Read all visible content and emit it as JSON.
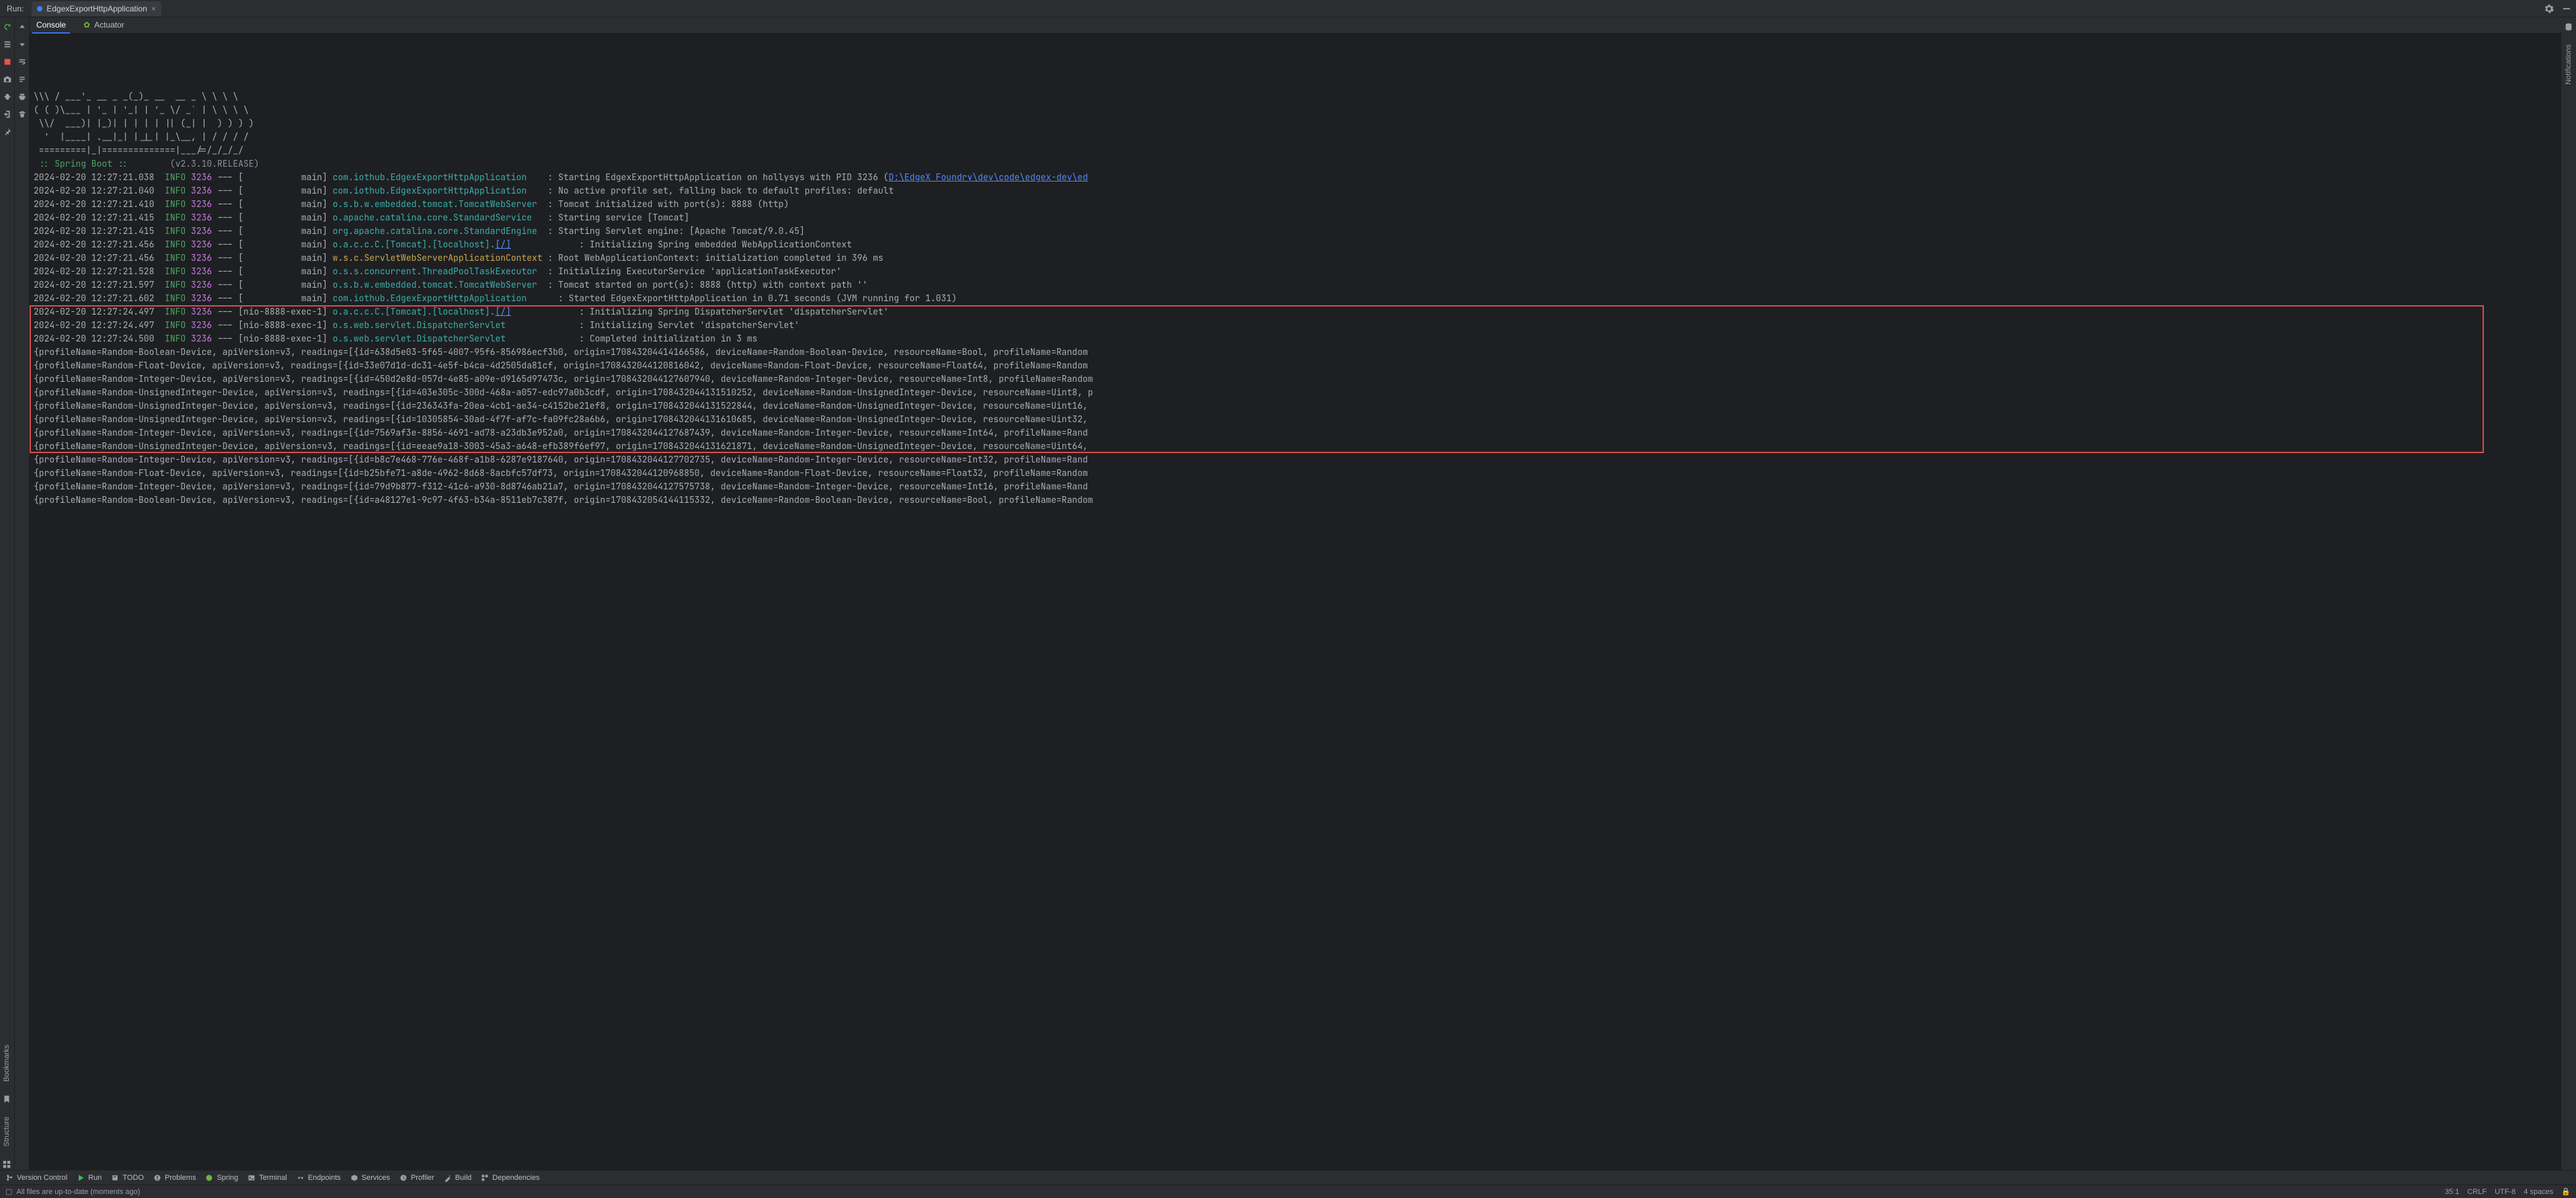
{
  "header": {
    "run_label": "Run:",
    "run_config": "EdgexExportHttpApplication",
    "close_glyph": "×"
  },
  "tabs": {
    "console": "Console",
    "actuator": "Actuator"
  },
  "right_panel_label": "Notifications",
  "left_panels": {
    "bookmarks": "Bookmarks",
    "structure": "Structure"
  },
  "banner": {
    "ascii": [
      "\\\\\\ / ___'_ __ _ _(_)_ __  __ _ \\ \\ \\ \\",
      "( ( )\\___ | '_ | '_| | '_ \\/ _` | \\ \\ \\ \\",
      " \\\\/  ___)| |_)| | | | | || (_| |  ) ) ) )",
      "  '  |____| .__|_| |_|_| |_\\__, | / / / /",
      " =========|_|==============|___/=/_/_/_/"
    ],
    "tag": " :: Spring Boot :: ",
    "version": "(v2.3.10.RELEASE)"
  },
  "log_columns": {
    "info": "INFO",
    "pid": "3236",
    "sep": " --- ",
    "thread_main": "[           main] ",
    "thread_nio": "[nio-8888-exec-1] "
  },
  "log": [
    {
      "ts": "2024-02-20 12:27:21.038",
      "thread": "main",
      "logger": "com.iothub.EdgexExportHttpApplication",
      "msg_prefix": " : Starting EdgexExportHttpApplication on hollysys with PID 3236 (",
      "link": "D:\\EdgeX Foundry\\dev\\code\\edgex-dev\\ed",
      "msg_suffix": ""
    },
    {
      "ts": "2024-02-20 12:27:21.040",
      "thread": "main",
      "logger": "com.iothub.EdgexExportHttpApplication",
      "msg": " : No active profile set, falling back to default profiles: default"
    },
    {
      "ts": "2024-02-20 12:27:21.410",
      "thread": "main",
      "logger": "o.s.b.w.embedded.tomcat.TomcatWebServer",
      "msg": " : Tomcat initialized with port(s): 8888 (http)"
    },
    {
      "ts": "2024-02-20 12:27:21.415",
      "thread": "main",
      "logger": "o.apache.catalina.core.StandardService",
      "msg": " : Starting service [Tomcat]"
    },
    {
      "ts": "2024-02-20 12:27:21.415",
      "thread": "main",
      "logger": "org.apache.catalina.core.StandardEngine",
      "msg": " : Starting Servlet engine: [Apache Tomcat/9.0.45]"
    },
    {
      "ts": "2024-02-20 12:27:21.456",
      "thread": "main",
      "logger_pre": "o.a.c.c.C.[Tomcat].[localhost].",
      "logger_link": "[/]",
      "msg": "       : Initializing Spring embedded WebApplicationContext"
    },
    {
      "ts": "2024-02-20 12:27:21.456",
      "thread": "main",
      "logger_y": "w.s.c.ServletWebServerApplicationContext",
      "msg": " : Root WebApplicationContext: initialization completed in 396 ms"
    },
    {
      "ts": "2024-02-20 12:27:21.528",
      "thread": "main",
      "logger": "o.s.s.concurrent.ThreadPoolTaskExecutor",
      "msg": " : Initializing ExecutorService 'applicationTaskExecutor'"
    },
    {
      "ts": "2024-02-20 12:27:21.597",
      "thread": "main",
      "logger": "o.s.b.w.embedded.tomcat.TomcatWebServer",
      "msg": " : Tomcat started on port(s): 8888 (http) with context path ''"
    },
    {
      "ts": "2024-02-20 12:27:21.602",
      "thread": "main",
      "logger": "com.iothub.EdgexExportHttpApplication",
      "msg": "   : Started EdgexExportHttpApplication in 0.71 seconds (JVM running for 1.031)"
    },
    {
      "ts": "2024-02-20 12:27:24.497",
      "thread": "nio",
      "logger_pre": "o.a.c.c.C.[Tomcat].[localhost].",
      "logger_link": "[/]",
      "msg": "       : Initializing Spring DispatcherServlet 'dispatcherServlet'"
    },
    {
      "ts": "2024-02-20 12:27:24.497",
      "thread": "nio",
      "logger": "o.s.web.servlet.DispatcherServlet",
      "msg": "       : Initializing Servlet 'dispatcherServlet'"
    },
    {
      "ts": "2024-02-20 12:27:24.500",
      "thread": "nio",
      "logger": "o.s.web.servlet.DispatcherServlet",
      "msg": "       : Completed initialization in 3 ms"
    }
  ],
  "payload": [
    "{profileName=Random-Boolean-Device, apiVersion=v3, readings=[{id=638d5e03-5f65-4007-95f6-856986ecf3b0, origin=170843204414166586, deviceName=Random-Boolean-Device, resourceName=Bool, profileName=Random",
    "{profileName=Random-Float-Device, apiVersion=v3, readings=[{id=33e07d1d-dc31-4e5f-b4ca-4d2505da81cf, origin=1708432044120816042, deviceName=Random-Float-Device, resourceName=Float64, profileName=Random",
    "{profileName=Random-Integer-Device, apiVersion=v3, readings=[{id=450d2e8d-057d-4e85-a09e-d9165d97473c, origin=1708432044127607940, deviceName=Random-Integer-Device, resourceName=Int8, profileName=Random",
    "{profileName=Random-UnsignedInteger-Device, apiVersion=v3, readings=[{id=403e305c-300d-468a-a057-edc97a0b3cdf, origin=1708432044131510252, deviceName=Random-UnsignedInteger-Device, resourceName=Uint8, p",
    "{profileName=Random-UnsignedInteger-Device, apiVersion=v3, readings=[{id=236343fa-20ea-4cb1-ae34-c4152be21ef8, origin=1708432044131522844, deviceName=Random-UnsignedInteger-Device, resourceName=Uint16, ",
    "{profileName=Random-UnsignedInteger-Device, apiVersion=v3, readings=[{id=10305854-30ad-4f7f-af7c-fa09fc28a6b6, origin=1708432044131610685, deviceName=Random-UnsignedInteger-Device, resourceName=Uint32, ",
    "{profileName=Random-Integer-Device, apiVersion=v3, readings=[{id=7569af3e-8856-4691-ad78-a23db3e952a0, origin=1708432044127687439, deviceName=Random-Integer-Device, resourceName=Int64, profileName=Rand",
    "{profileName=Random-UnsignedInteger-Device, apiVersion=v3, readings=[{id=eeae9a18-3003-45a3-a648-efb389f6ef97, origin=1708432044131621871, deviceName=Random-UnsignedInteger-Device, resourceName=Uint64, ",
    "{profileName=Random-Integer-Device, apiVersion=v3, readings=[{id=b8c7e468-776e-468f-a1b8-6287e9187640, origin=1708432044127702735, deviceName=Random-Integer-Device, resourceName=Int32, profileName=Rand",
    "{profileName=Random-Float-Device, apiVersion=v3, readings=[{id=b25bfe71-a8de-4962-8d68-8acbfc57df73, origin=1708432044120968850, deviceName=Random-Float-Device, resourceName=Float32, profileName=Random",
    "{profileName=Random-Integer-Device, apiVersion=v3, readings=[{id=79d9b877-f312-41c6-a930-8d8746ab21a7, origin=1708432044127575738, deviceName=Random-Integer-Device, resourceName=Int16, profileName=Rand",
    "{profileName=Random-Boolean-Device, apiVersion=v3, readings=[{id=a48127e1-9c97-4f63-b34a-8511eb7c387f, origin=1708432054144115332, deviceName=Random-Boolean-Device, resourceName=Bool, profileName=Random"
  ],
  "bottombar": {
    "version_control": "Version Control",
    "run": "Run",
    "todo": "TODO",
    "problems": "Problems",
    "spring": "Spring",
    "terminal": "Terminal",
    "endpoints": "Endpoints",
    "services": "Services",
    "profiler": "Profiler",
    "build": "Build",
    "dependencies": "Dependencies"
  },
  "statusbar": {
    "left": "All files are up-to-date (moments ago)",
    "caret": "35:1",
    "line_sep": "CRLF",
    "encoding": "UTF-8",
    "indent": "4 spaces"
  }
}
